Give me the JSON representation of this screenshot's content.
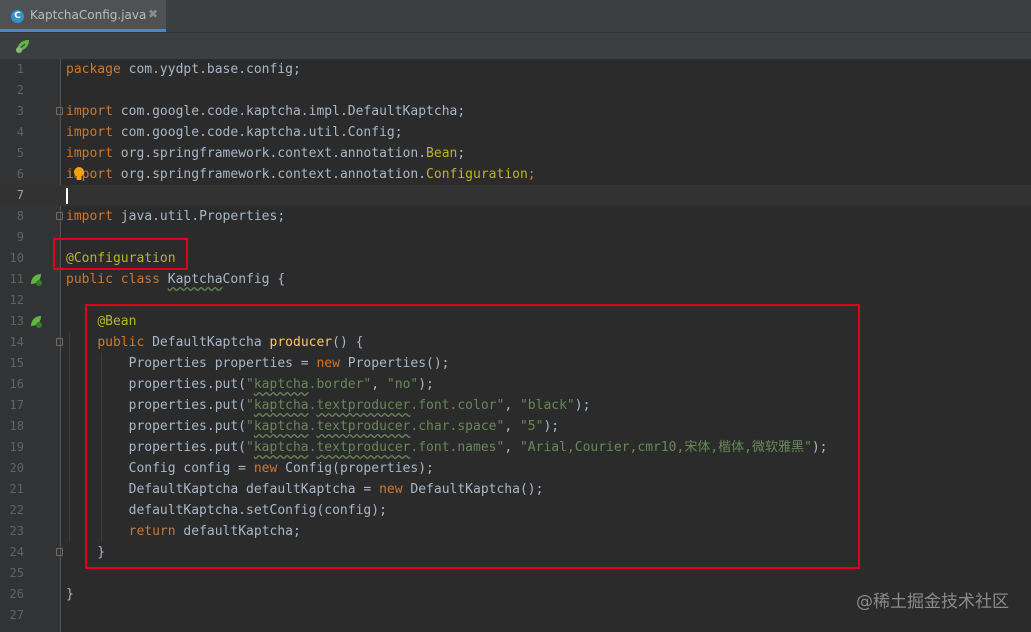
{
  "tab": {
    "label": "KaptchaConfig.java",
    "icon_letter": "C",
    "close": "✖"
  },
  "lines": [
    {
      "n": "1",
      "parts": [
        [
          "k",
          "package "
        ],
        [
          "p",
          "com.yydpt.base.config;"
        ]
      ]
    },
    {
      "n": "2",
      "parts": []
    },
    {
      "n": "3",
      "parts": [
        [
          "k",
          "import "
        ],
        [
          "p",
          "com.google.code.kaptcha.impl.DefaultKaptcha;"
        ]
      ]
    },
    {
      "n": "4",
      "parts": [
        [
          "k",
          "import "
        ],
        [
          "p",
          "com.google.code.kaptcha.util.Config;"
        ]
      ]
    },
    {
      "n": "5",
      "parts": [
        [
          "k",
          "import "
        ],
        [
          "p",
          "org.springframework.context.annotation."
        ],
        [
          "a",
          "Bean"
        ],
        [
          "p",
          ";"
        ]
      ]
    },
    {
      "n": "6",
      "parts": [
        [
          "k",
          "import "
        ],
        [
          "p",
          "org.springframework.context.annotation."
        ],
        [
          "a",
          "Configuration"
        ],
        [
          "k",
          ";"
        ]
      ]
    },
    {
      "n": "7",
      "parts": []
    },
    {
      "n": "8",
      "parts": [
        [
          "k",
          "import "
        ],
        [
          "p",
          "java.util.Properties;"
        ]
      ]
    },
    {
      "n": "9",
      "parts": []
    },
    {
      "n": "10",
      "parts": [
        [
          "a",
          "@Configuration"
        ]
      ]
    },
    {
      "n": "11",
      "parts": [
        [
          "k",
          "public class "
        ],
        [
          "u",
          "Kaptcha"
        ],
        [
          "p",
          "Config {"
        ]
      ]
    },
    {
      "n": "12",
      "parts": []
    },
    {
      "n": "13",
      "parts": [
        [
          "p",
          "    "
        ],
        [
          "a",
          "@Bean"
        ]
      ]
    },
    {
      "n": "14",
      "parts": [
        [
          "p",
          "    "
        ],
        [
          "k",
          "public "
        ],
        [
          "p",
          "DefaultKaptcha "
        ],
        [
          "f",
          "producer"
        ],
        [
          "p",
          "() {"
        ]
      ]
    },
    {
      "n": "15",
      "parts": [
        [
          "p",
          "        Properties properties = "
        ],
        [
          "k",
          "new "
        ],
        [
          "p",
          "Properties();"
        ]
      ]
    },
    {
      "n": "16",
      "parts": [
        [
          "p",
          "        properties.put("
        ],
        [
          "s",
          "\""
        ],
        [
          "su",
          "kaptcha"
        ],
        [
          "s",
          ".border\""
        ],
        [
          "p",
          ", "
        ],
        [
          "s",
          "\"no\""
        ],
        [
          "p",
          ");"
        ]
      ]
    },
    {
      "n": "17",
      "parts": [
        [
          "p",
          "        properties.put("
        ],
        [
          "s",
          "\""
        ],
        [
          "su",
          "kaptcha"
        ],
        [
          "s",
          "."
        ],
        [
          "su",
          "textproducer"
        ],
        [
          "s",
          ".font.color\""
        ],
        [
          "p",
          ", "
        ],
        [
          "s",
          "\"black\""
        ],
        [
          "p",
          ");"
        ]
      ]
    },
    {
      "n": "18",
      "parts": [
        [
          "p",
          "        properties.put("
        ],
        [
          "s",
          "\""
        ],
        [
          "su",
          "kaptcha"
        ],
        [
          "s",
          "."
        ],
        [
          "su",
          "textproducer"
        ],
        [
          "s",
          ".char.space\""
        ],
        [
          "p",
          ", "
        ],
        [
          "s",
          "\"5\""
        ],
        [
          "p",
          ");"
        ]
      ]
    },
    {
      "n": "19",
      "parts": [
        [
          "p",
          "        properties.put("
        ],
        [
          "s",
          "\""
        ],
        [
          "su",
          "kaptcha"
        ],
        [
          "s",
          "."
        ],
        [
          "su",
          "textproducer"
        ],
        [
          "s",
          ".font.names\""
        ],
        [
          "p",
          ", "
        ],
        [
          "s",
          "\"Arial,Courier,cmr10,宋体,楷体,微软雅黑\""
        ],
        [
          "p",
          ");"
        ]
      ]
    },
    {
      "n": "20",
      "parts": [
        [
          "p",
          "        Config config = "
        ],
        [
          "k",
          "new "
        ],
        [
          "p",
          "Config(properties);"
        ]
      ]
    },
    {
      "n": "21",
      "parts": [
        [
          "p",
          "        DefaultKaptcha defaultKaptcha = "
        ],
        [
          "k",
          "new "
        ],
        [
          "p",
          "DefaultKaptcha();"
        ]
      ]
    },
    {
      "n": "22",
      "parts": [
        [
          "p",
          "        defaultKaptcha.setConfig(config);"
        ]
      ]
    },
    {
      "n": "23",
      "parts": [
        [
          "p",
          "        "
        ],
        [
          "k",
          "return "
        ],
        [
          "p",
          "defaultKaptcha;"
        ]
      ]
    },
    {
      "n": "24",
      "parts": [
        [
          "p",
          "    }"
        ]
      ]
    },
    {
      "n": "25",
      "parts": []
    },
    {
      "n": "26",
      "parts": [
        [
          "p",
          "}"
        ]
      ]
    },
    {
      "n": "27",
      "parts": []
    }
  ],
  "current_line": "7",
  "fold_markers": [
    "3",
    "8",
    "14",
    "24"
  ],
  "colors": {
    "keyword": "#cc7832",
    "string": "#6a8759",
    "annotation": "#bbb529",
    "method": "#ffc66d",
    "plain": "#a9b7c6",
    "highlight": "#e0001e"
  },
  "watermark": "@稀土掘金技术社区"
}
